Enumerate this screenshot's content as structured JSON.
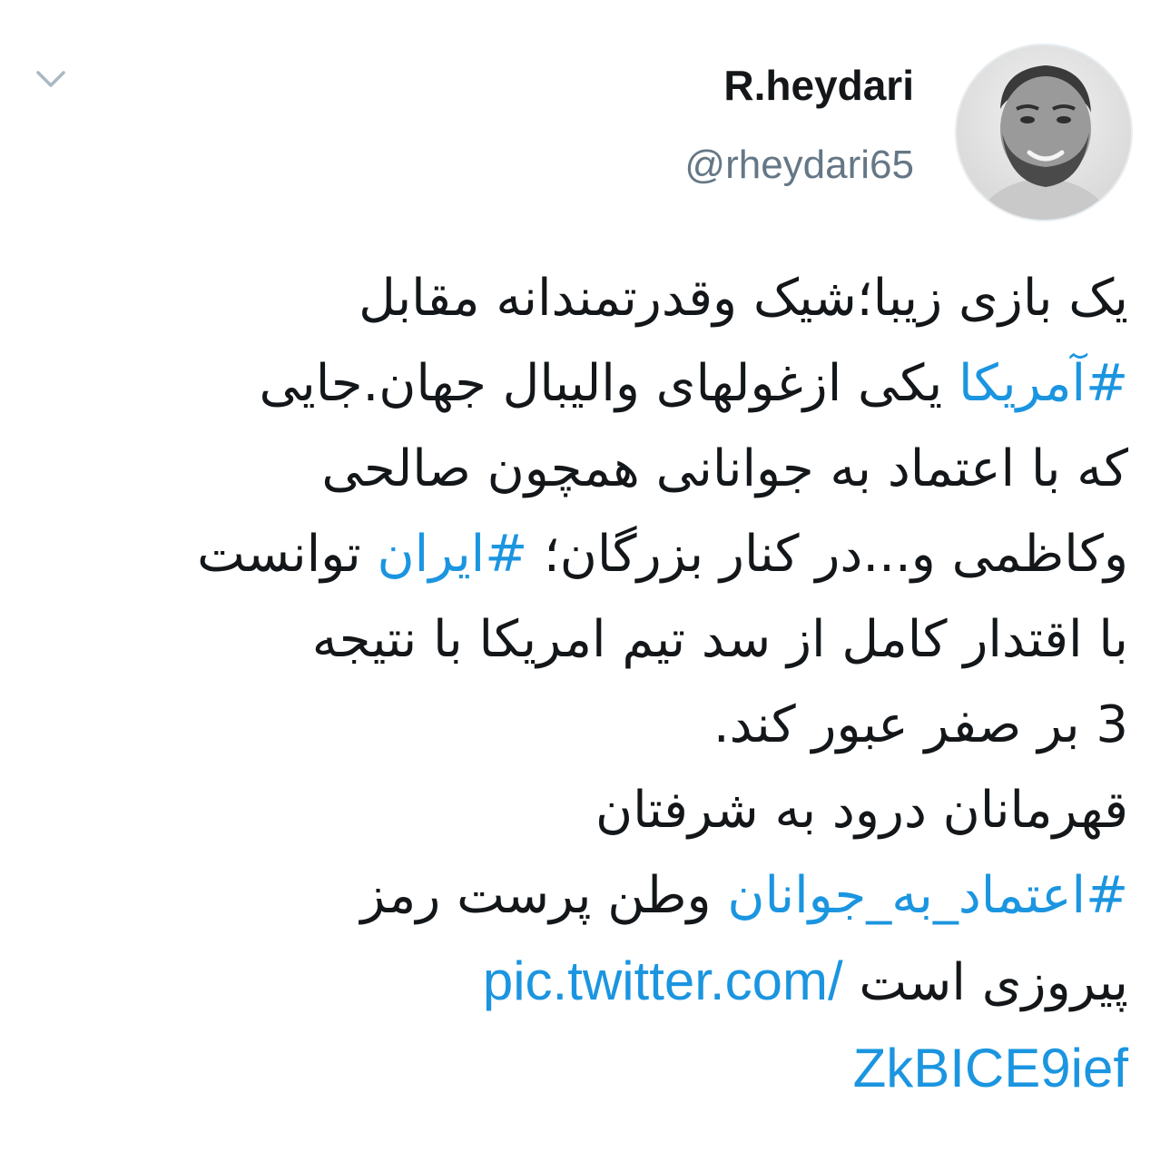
{
  "user": {
    "display_name": "R.heydari",
    "handle": "@rheydari65"
  },
  "tweet": {
    "line1": "یک بازی زیبا؛شیک وقدرتمندانه مقابل",
    "hashtag_america": "#آمریکا",
    "line2_rest": " یکی ازغولهای والیبال جهان.جایی",
    "line3": "که با اعتماد به جوانانی همچون صالحی",
    "line4_start": "وکاظمی و...در کنار بزرگان؛ ",
    "hashtag_iran": "#ایران",
    "line4_end": " توانست",
    "line5": "با اقتدار کامل از سد تیم امریکا با نتیجه",
    "line6": "3 بر صفر عبور کند.",
    "line7": "قهرمانان درود به شرفتان",
    "hashtag_trust": "#اعتماد_به_جوانان",
    "line8_rest": " وطن پرست رمز",
    "line9_text": "پیروزی است ",
    "link_part1": "pic.twitter.com/",
    "link_part2": "ZkBICE9ief"
  },
  "colors": {
    "text": "#14171a",
    "secondary": "#657786",
    "link": "#1b95e0"
  },
  "icons": {
    "menu": "chevron-down-icon"
  }
}
